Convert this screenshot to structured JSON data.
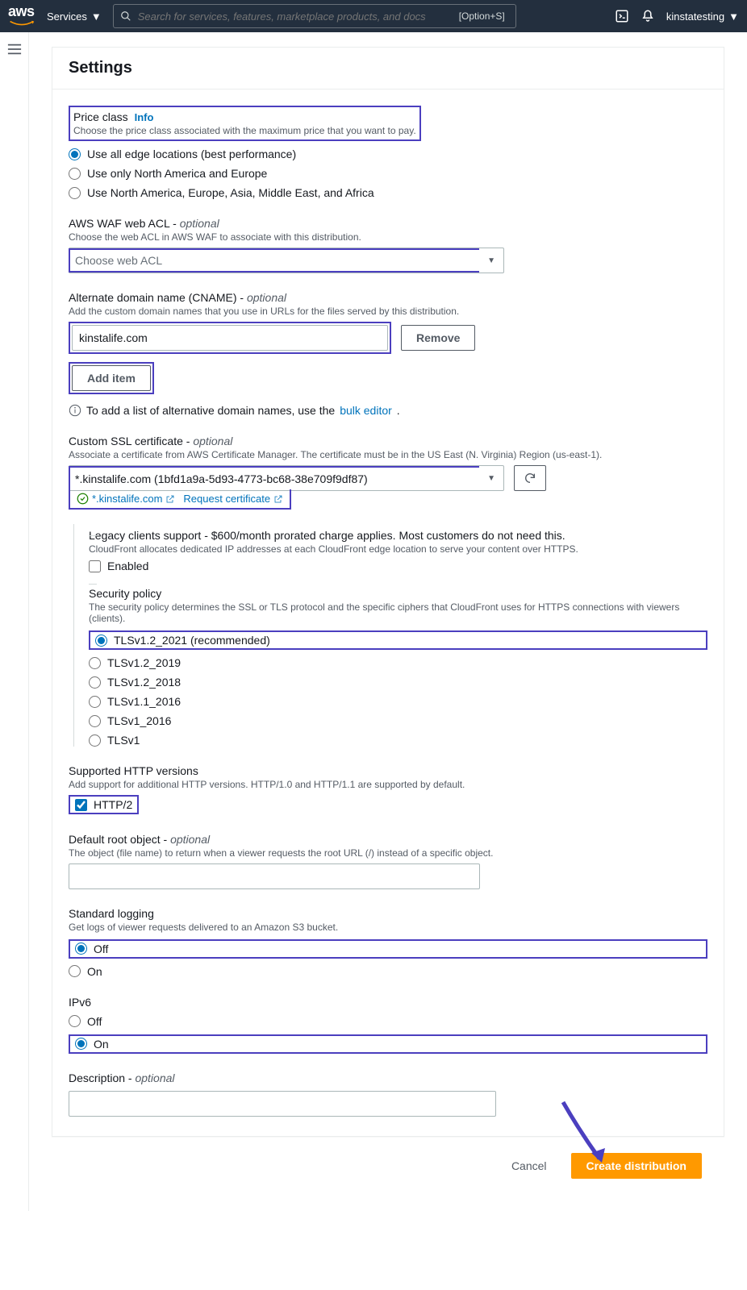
{
  "nav": {
    "services": "Services",
    "search_placeholder": "Search for services, features, marketplace products, and docs",
    "shortcut": "[Option+S]",
    "username": "kinstatesting"
  },
  "panel": {
    "title": "Settings"
  },
  "price_class": {
    "label": "Price class",
    "info": "Info",
    "desc": "Choose the price class associated with the maximum price that you want to pay.",
    "options": [
      "Use all edge locations (best performance)",
      "Use only North America and Europe",
      "Use North America, Europe, Asia, Middle East, and Africa"
    ]
  },
  "waf": {
    "label": "AWS WAF web ACL - ",
    "opt": "optional",
    "desc": "Choose the web ACL in AWS WAF to associate with this distribution.",
    "placeholder": "Choose web ACL"
  },
  "cname": {
    "label": "Alternate domain name (CNAME) - ",
    "opt": "optional",
    "desc": "Add the custom domain names that you use in URLs for the files served by this distribution.",
    "value": "kinstalife.com",
    "remove": "Remove",
    "add": "Add item",
    "hint_pre": "To add a list of alternative domain names, use the ",
    "hint_link": "bulk editor"
  },
  "ssl": {
    "label": "Custom SSL certificate - ",
    "opt": "optional",
    "desc": "Associate a certificate from AWS Certificate Manager. The certificate must be in the US East (N. Virginia) Region (us-east-1).",
    "value": "*.kinstalife.com (1bfd1a9a-5d93-4773-bc68-38e709f9df87)",
    "verified": "*.kinstalife.com",
    "request": "Request certificate"
  },
  "legacy": {
    "title": "Legacy clients support - $600/month prorated charge applies. Most customers do not need this.",
    "desc": "CloudFront allocates dedicated IP addresses at each CloudFront edge location to serve your content over HTTPS.",
    "checkbox": "Enabled"
  },
  "sec_policy": {
    "label": "Security policy",
    "desc": "The security policy determines the SSL or TLS protocol and the specific ciphers that CloudFront uses for HTTPS connections with viewers (clients).",
    "options": [
      "TLSv1.2_2021 (recommended)",
      "TLSv1.2_2019",
      "TLSv1.2_2018",
      "TLSv1.1_2016",
      "TLSv1_2016",
      "TLSv1"
    ]
  },
  "http": {
    "label": "Supported HTTP versions",
    "desc": "Add support for additional HTTP versions. HTTP/1.0 and HTTP/1.1 are supported by default.",
    "checkbox": "HTTP/2"
  },
  "root": {
    "label": "Default root object - ",
    "opt": "optional",
    "desc": "The object (file name) to return when a viewer requests the root URL (/) instead of a specific object."
  },
  "logging": {
    "label": "Standard logging",
    "desc": "Get logs of viewer requests delivered to an Amazon S3 bucket.",
    "off": "Off",
    "on": "On"
  },
  "ipv6": {
    "label": "IPv6",
    "off": "Off",
    "on": "On"
  },
  "description": {
    "label": "Description - ",
    "opt": "optional"
  },
  "footer": {
    "cancel": "Cancel",
    "create": "Create distribution"
  }
}
